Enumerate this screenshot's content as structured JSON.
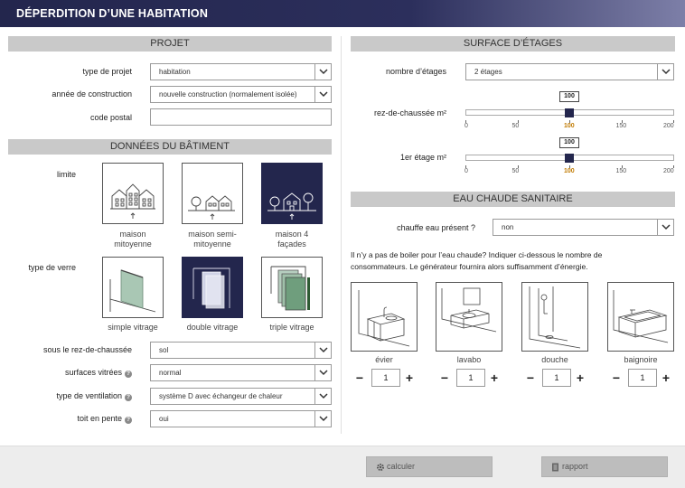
{
  "title": "DÉPERDITION D’UNE HABITATION",
  "projet": {
    "heading": "PROJET",
    "type_label": "type de projet",
    "type_value": "habitation",
    "annee_label": "année de construction",
    "annee_value": "nouvelle construction (normalement isolée)",
    "cp_label": "code postal",
    "cp_value": ""
  },
  "batiment": {
    "heading": "DONNÉES DU BÂTIMENT",
    "limite_label": "limite",
    "limite_options": [
      {
        "line1": "maison",
        "line2": "mitoyenne",
        "selected": false
      },
      {
        "line1": "maison semi-",
        "line2": "mitoyenne",
        "selected": false
      },
      {
        "line1": "maison 4",
        "line2": "façades",
        "selected": true
      }
    ],
    "verre_label": "type de verre",
    "verre_options": [
      {
        "label": "simple vitrage",
        "selected": false
      },
      {
        "label": "double vitrage",
        "selected": true
      },
      {
        "label": "triple vitrage",
        "selected": false
      }
    ],
    "sous_label": "sous le rez-de-chaussée",
    "sous_value": "sol",
    "surf_label": "surfaces vitrées",
    "surf_value": "normal",
    "vent_label": "type de ventilation",
    "vent_value": "système D avec échangeur de chaleur",
    "toit_label": "toit en pente",
    "toit_value": "oui",
    "help_glyph": "?"
  },
  "surface": {
    "heading": "SURFACE D’ÉTAGES",
    "nombre_label": "nombre d’étages",
    "nombre_value": "2 étages",
    "rez_label": "rez-de-chaussée m²",
    "rez_value": "100",
    "etage_label": "1er étage m²",
    "etage_value": "100",
    "slider_min": 0,
    "slider_max": 200,
    "ticks": [
      "0",
      "50",
      "100",
      "150",
      "200"
    ],
    "active_tick": "100"
  },
  "eau": {
    "heading": "EAU CHAUDE SANITAIRE",
    "chauffe_label": "chauffe eau présent ?",
    "chauffe_value": "non",
    "note_line1": "Il n’y a pas de boiler pour l’eau chaude? Indiquer ci-dessous le nombre de",
    "note_line2": "consommateurs. Le générateur fournira alors suffisamment d’énergie.",
    "items": [
      {
        "label": "évier",
        "count": "1"
      },
      {
        "label": "lavabo",
        "count": "1"
      },
      {
        "label": "douche",
        "count": "1"
      },
      {
        "label": "baignoire",
        "count": "1"
      }
    ],
    "minus": "−",
    "plus": "+"
  },
  "footer": {
    "calculer": "calculer",
    "rapport": "rapport"
  },
  "colors": {
    "accent": "#23264d",
    "section_header": "#c9c9c9",
    "active_tick": "#c07a00"
  }
}
